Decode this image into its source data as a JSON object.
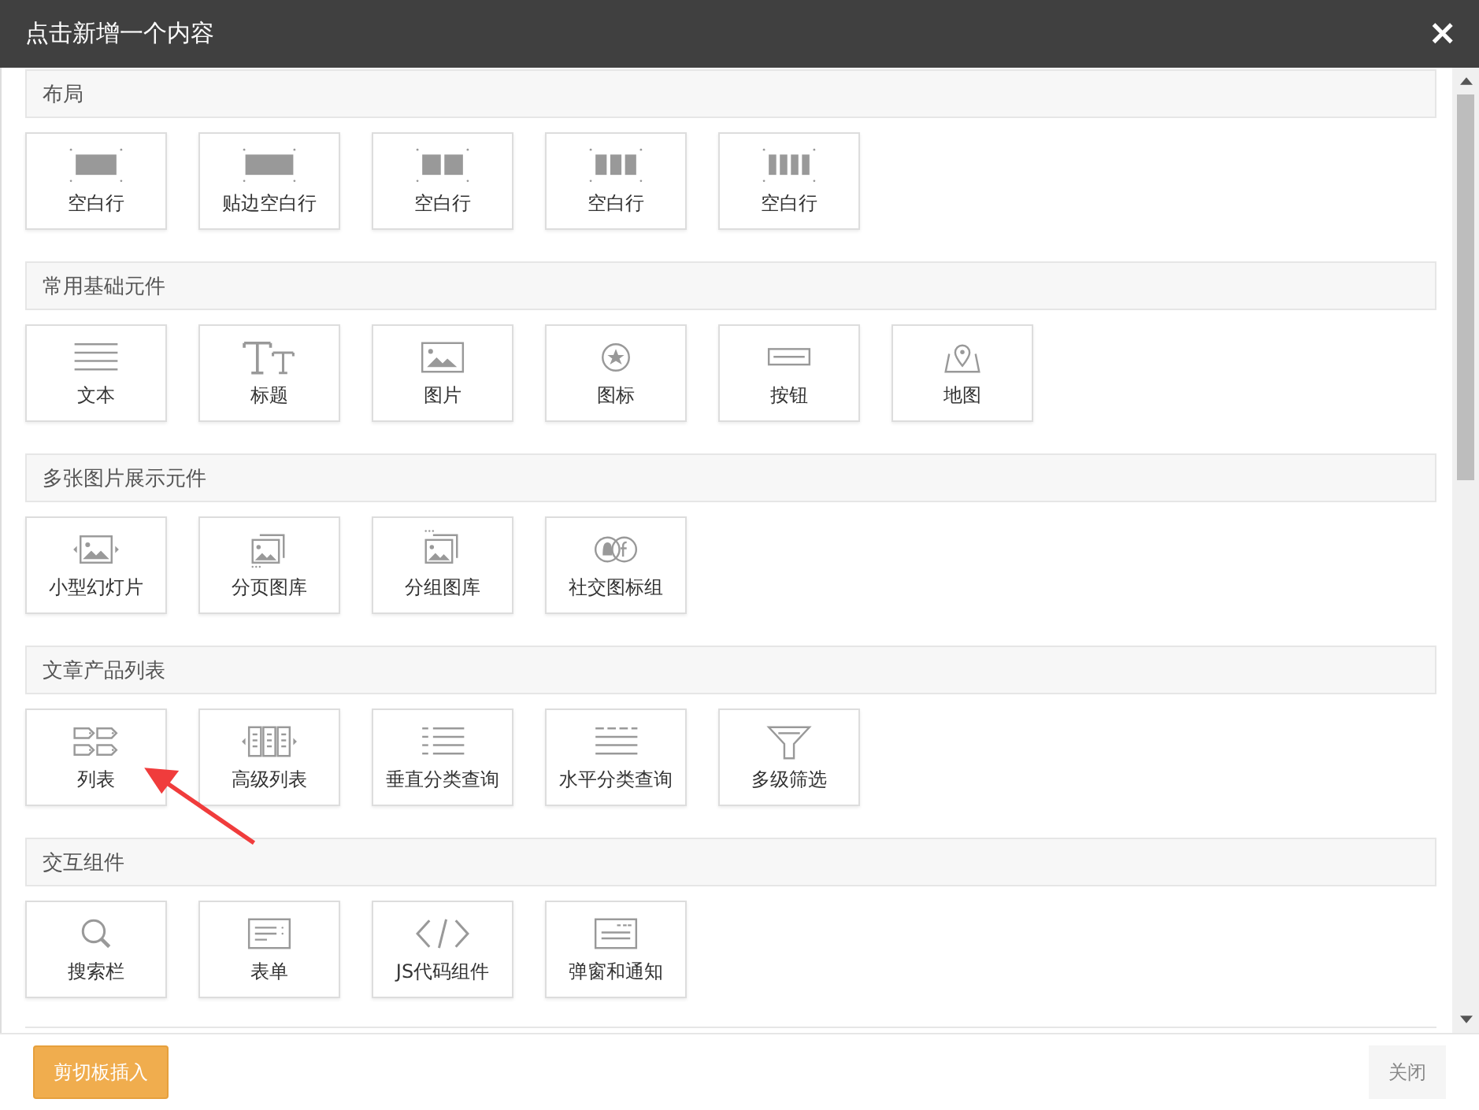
{
  "dialog": {
    "title": "点击新增一个内容",
    "close": "×"
  },
  "sections": [
    {
      "title": "布局",
      "items": [
        {
          "label": "空白行",
          "kind": "blank1"
        },
        {
          "label": "贴边空白行",
          "kind": "blankfull"
        },
        {
          "label": "空白行",
          "kind": "blank2"
        },
        {
          "label": "空白行",
          "kind": "blank3"
        },
        {
          "label": "空白行",
          "kind": "blank4"
        }
      ]
    },
    {
      "title": "常用基础元件",
      "items": [
        {
          "label": "文本",
          "kind": "text"
        },
        {
          "label": "标题",
          "kind": "heading"
        },
        {
          "label": "图片",
          "kind": "image"
        },
        {
          "label": "图标",
          "kind": "staricon"
        },
        {
          "label": "按钮",
          "kind": "button"
        },
        {
          "label": "地图",
          "kind": "map"
        }
      ]
    },
    {
      "title": "多张图片展示元件",
      "items": [
        {
          "label": "小型幻灯片",
          "kind": "slider"
        },
        {
          "label": "分页图库",
          "kind": "paged"
        },
        {
          "label": "分组图库",
          "kind": "grouped"
        },
        {
          "label": "社交图标组",
          "kind": "social"
        }
      ]
    },
    {
      "title": "文章产品列表",
      "items": [
        {
          "label": "列表",
          "kind": "list"
        },
        {
          "label": "高级列表",
          "kind": "advlist"
        },
        {
          "label": "垂直分类查询",
          "kind": "vcat"
        },
        {
          "label": "水平分类查询",
          "kind": "hcat"
        },
        {
          "label": "多级筛选",
          "kind": "filter"
        }
      ]
    },
    {
      "title": "交互组件",
      "items": [
        {
          "label": "搜索栏",
          "kind": "search"
        },
        {
          "label": "表单",
          "kind": "form"
        },
        {
          "label": "JS代码组件",
          "kind": "code"
        },
        {
          "label": "弹窗和通知",
          "kind": "popup"
        }
      ]
    }
  ],
  "footer": {
    "paste_button": "剪切板插入",
    "close_button": "关闭"
  }
}
